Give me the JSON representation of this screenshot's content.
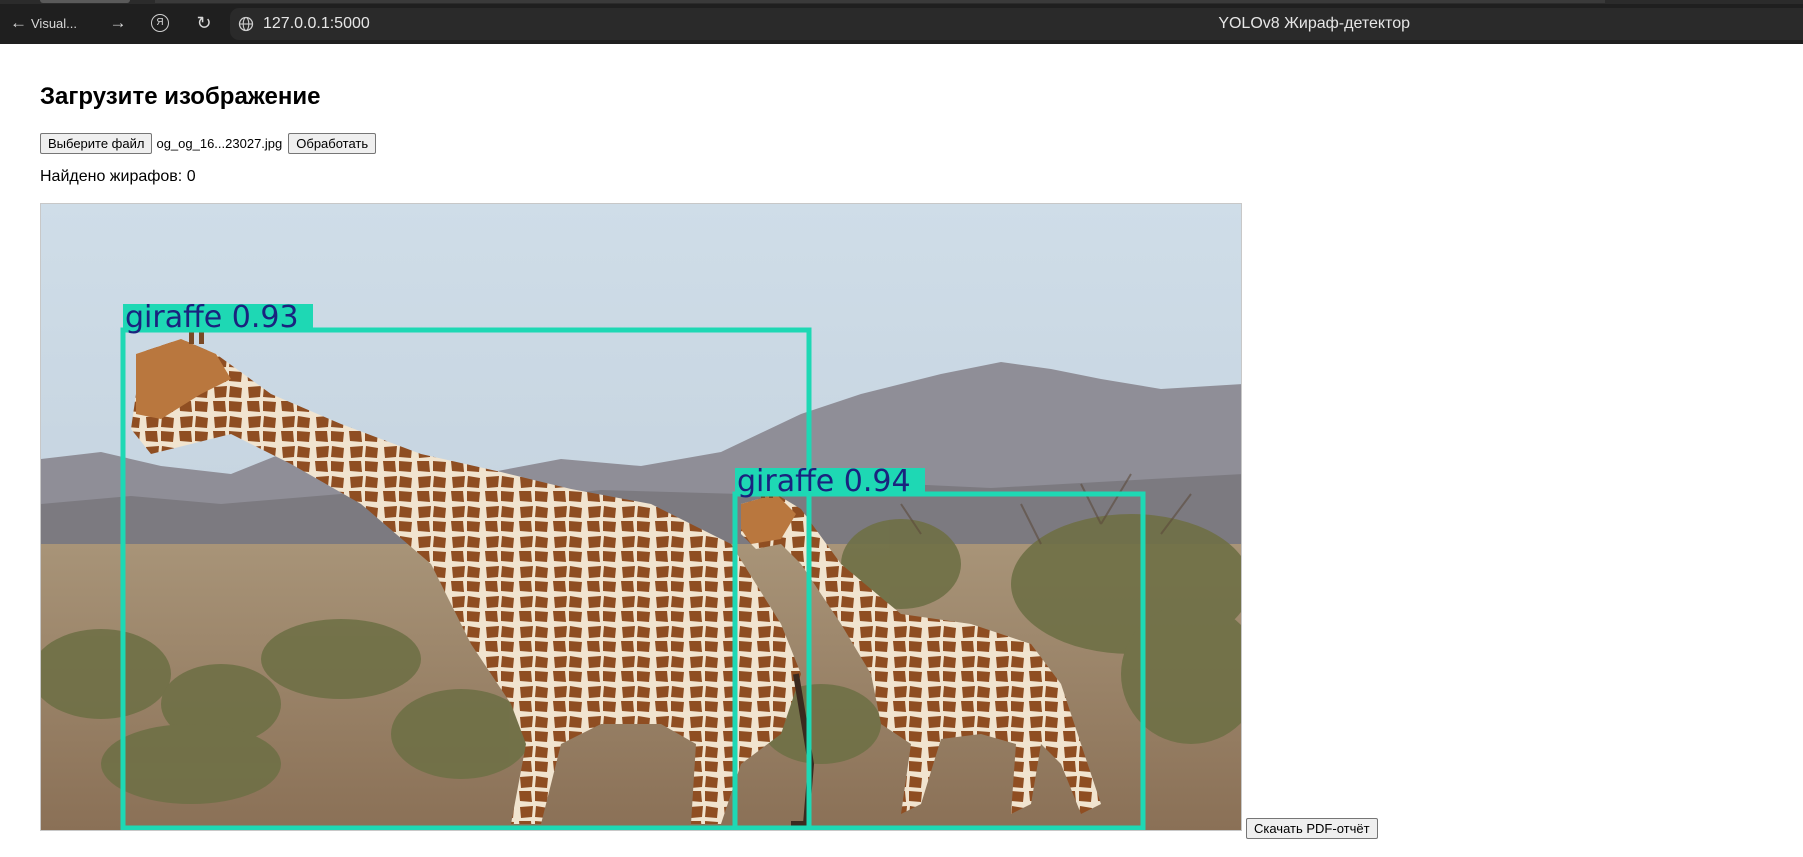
{
  "browser": {
    "back_label": "Visual...",
    "url": "127.0.0.1:5000",
    "page_title": "YOLOv8 Жираф-детектор",
    "ya_label": "Я"
  },
  "page": {
    "heading": "Загрузите изображение",
    "file_button": "Выберите файл",
    "file_name": "og_og_16...23027.jpg",
    "process_button": "Обработать",
    "result_text": "Найдено жирафов: 0",
    "pdf_button": "Скачать PDF-отчёт"
  },
  "detections": [
    {
      "label": "giraffe 0.93",
      "class": "giraffe",
      "confidence": 0.93
    },
    {
      "label": "giraffe 0.94",
      "class": "giraffe",
      "confidence": 0.94
    }
  ],
  "colors": {
    "box": "#1ed8b4",
    "label_text": "#1a237e",
    "chrome_bg": "#1f1f1f"
  },
  "icons": [
    "back-arrow-icon",
    "forward-arrow-icon",
    "yandex-icon",
    "reload-icon",
    "globe-icon"
  ]
}
